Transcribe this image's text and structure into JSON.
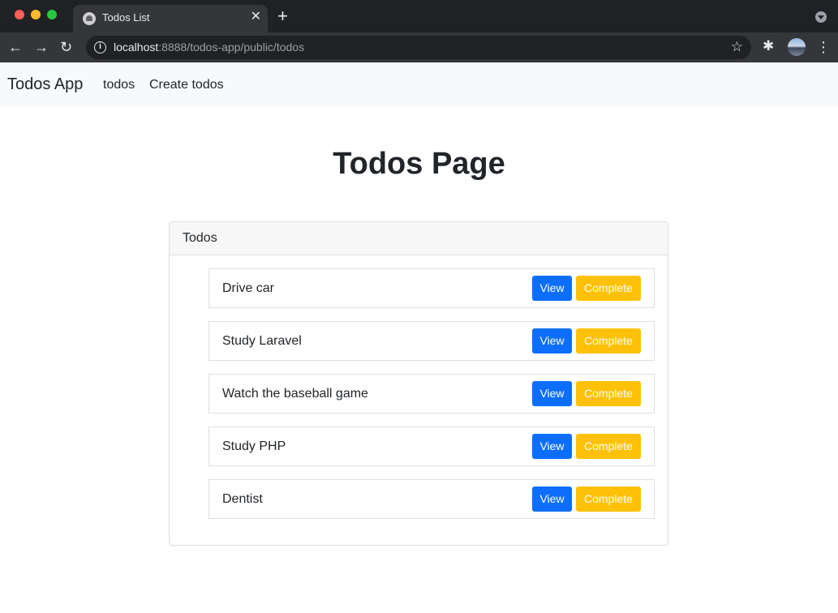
{
  "browser": {
    "tab_title": "Todos List",
    "tab_close": "✕",
    "new_tab": "+",
    "url_host": "localhost",
    "url_rest": ":8888/todos-app/public/todos",
    "back": "←",
    "forward": "→",
    "reload": "↻",
    "info": "i",
    "star": "☆",
    "extensions": "✱",
    "menu": "⋮"
  },
  "navbar": {
    "brand": "Todos App",
    "links": [
      "todos",
      "Create todos"
    ]
  },
  "page": {
    "title": "Todos Page"
  },
  "card": {
    "header": "Todos",
    "todos": [
      {
        "title": "Drive car",
        "view_label": "View",
        "complete_label": "Complete"
      },
      {
        "title": "Study Laravel",
        "view_label": "View",
        "complete_label": "Complete"
      },
      {
        "title": "Watch the baseball game",
        "view_label": "View",
        "complete_label": "Complete"
      },
      {
        "title": "Study PHP",
        "view_label": "View",
        "complete_label": "Complete"
      },
      {
        "title": "Dentist",
        "view_label": "View",
        "complete_label": "Complete"
      }
    ]
  },
  "colors": {
    "primary": "#0d6efd",
    "warning": "#ffc107",
    "navbar_bg": "#f8f9fa"
  }
}
